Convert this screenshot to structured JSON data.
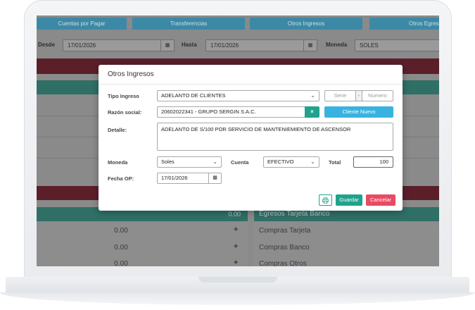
{
  "tabs": [
    {
      "label": "Cuentas por Pagar"
    },
    {
      "label": "Transferencias"
    },
    {
      "label": "Otros Ingresos"
    },
    {
      "label": "Otros Egres"
    }
  ],
  "filters": {
    "desde_label": "Desde",
    "desde_value": "17/01/2026",
    "hasta_label": "Hasta",
    "hasta_value": "17/01/2026",
    "moneda_label": "Moneda",
    "moneda_value": "SOLES",
    "calendar_icon": "calendar-icon"
  },
  "background": {
    "left_total": "0.00",
    "right_header": "Egresos Tarjeta Banco",
    "rows": [
      {
        "value": "0.00",
        "plus": "+",
        "label": "Compras Tarjeta"
      },
      {
        "value": "0.00",
        "plus": "+",
        "label": "Compras Banco"
      },
      {
        "value": "0.00",
        "plus": "+",
        "label": "Compras Otros"
      }
    ]
  },
  "modal": {
    "title": "Otros Ingresos",
    "tipo_ingreso_label": "Tipo Ingreso",
    "tipo_ingreso_value": "ADELANTO DE CLIENTES",
    "serie_placeholder": "Serie",
    "separator": "-",
    "numero_placeholder": "Numero",
    "razon_social_label": "Razón social:",
    "razon_social_value": "20602022341 - GRUPO SERGIN S.A.C.",
    "clear_symbol": "×",
    "cliente_nuevo_label": "Cliente Nuevo",
    "detalle_label": "Detalle:",
    "detalle_value": "ADELANTO DE S/100 POR SERVICIO DE MANTENIEMIENTO DE ASCENSOR",
    "moneda_label": "Moneda",
    "moneda_value": "Soles",
    "cuenta_label": "Cuenta",
    "cuenta_value": "EFECTIVO",
    "total_label": "Total",
    "total_value": "100",
    "fecha_op_label": "Fecha OP:",
    "fecha_op_value": "17/01/2026",
    "guardar_label": "Guardar",
    "cancelar_label": "Cancelar"
  },
  "colors": {
    "accent_teal": "#1fa38d",
    "accent_blue": "#38b3e0",
    "cancel_red": "#ea4a64"
  }
}
